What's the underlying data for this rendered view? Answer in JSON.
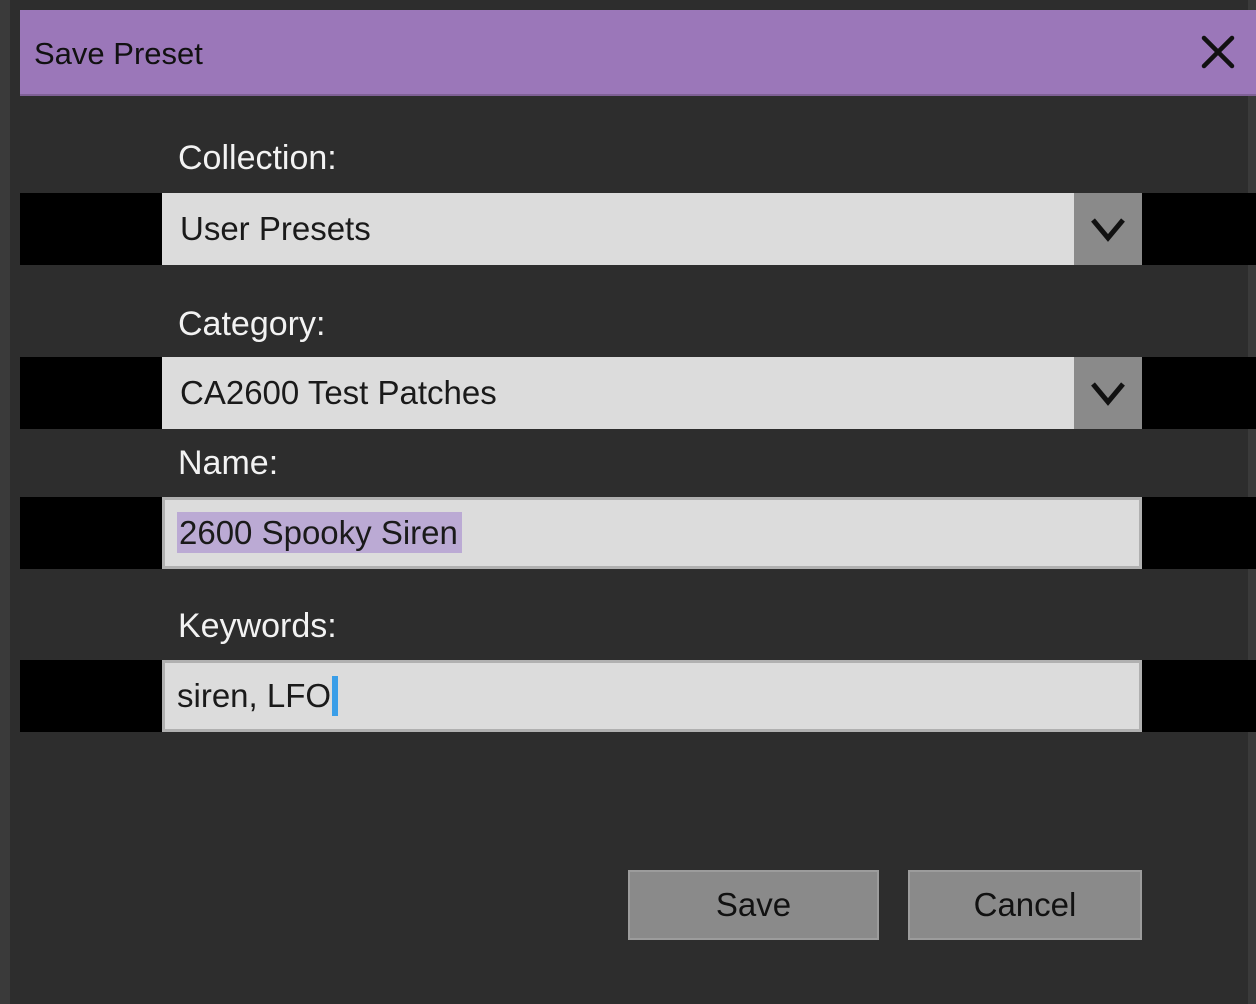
{
  "window": {
    "title": "Save Preset",
    "close_icon": "close-icon",
    "titlebar_color": "#9b77b9"
  },
  "form": {
    "collection": {
      "label": "Collection:",
      "value": "User Presets",
      "icon": "chevron-down-icon"
    },
    "category": {
      "label": "Category:",
      "value": "CA2600 Test Patches",
      "icon": "chevron-down-icon"
    },
    "name": {
      "label": "Name:",
      "value": "2600 Spooky Siren",
      "selected": true
    },
    "keywords": {
      "label": "Keywords:",
      "value": "siren, LFO",
      "caret_color": "#3a9ee8"
    }
  },
  "buttons": {
    "save_label": "Save",
    "cancel_label": "Cancel"
  }
}
